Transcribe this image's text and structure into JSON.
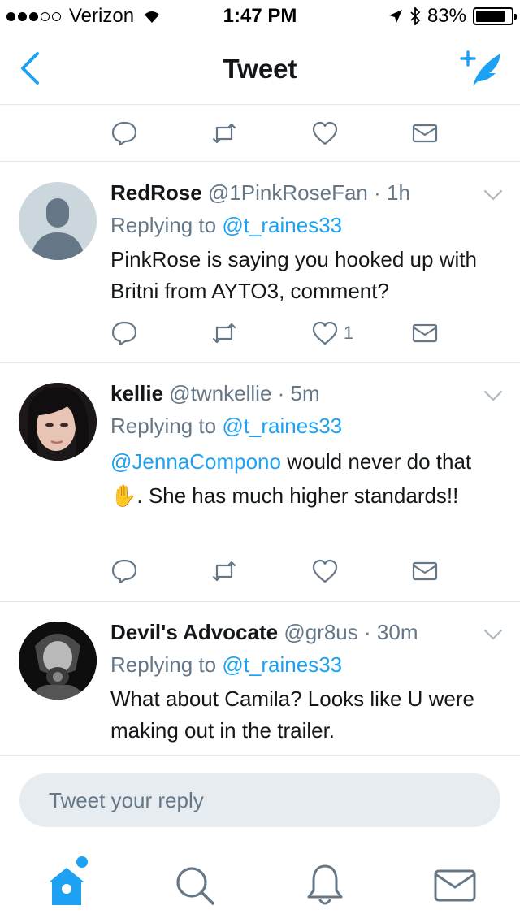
{
  "status": {
    "carrier": "Verizon",
    "time": "1:47 PM",
    "battery": "83%",
    "battery_level": 0.83
  },
  "nav": {
    "title": "Tweet"
  },
  "colors": {
    "accent": "#1da1f2",
    "text": "#14171a",
    "secondary": "#657786",
    "divider": "#e1e8ed"
  },
  "tweets": [
    {
      "name": "RedRose",
      "handle": "@1PinkRoseFan",
      "time": "1h",
      "replying_prefix": "Replying to",
      "replying_to": "@t_raines33",
      "body": "PinkRose is saying you hooked up with Britni from AYTO3, comment?",
      "like_count": "1"
    },
    {
      "name": "kellie",
      "handle": "@twnkellie",
      "time": "5m",
      "replying_prefix": "Replying to",
      "replying_to": "@t_raines33",
      "body_mention": "@JennaCompono",
      "body_part1": "would never do",
      "body_part2": "that",
      "body_emoji": "✋",
      "body_part3": ". She has much higher standards!!"
    },
    {
      "name": "Devil's Advocate",
      "handle": "@gr8us",
      "time": "30m",
      "replying_prefix": "Replying to",
      "replying_to": "@t_raines33",
      "body": "What about Camila? Looks like U were making out in the trailer."
    }
  ],
  "reply_box": {
    "placeholder": "Tweet your reply"
  },
  "icons": [
    "back-chevron-icon",
    "compose-tweet-icon",
    "reply-icon",
    "retweet-icon",
    "like-icon",
    "direct-message-icon",
    "home-icon",
    "search-icon",
    "notifications-icon",
    "messages-icon"
  ]
}
